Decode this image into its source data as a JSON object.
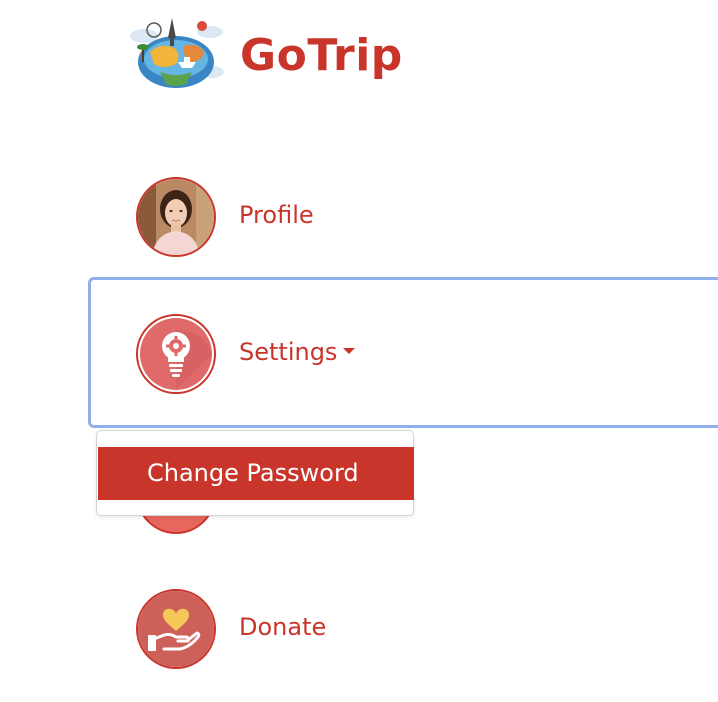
{
  "brand": {
    "name": "GoTrip",
    "logo_icon": "globe-travel-logo"
  },
  "menu": {
    "profile": {
      "label": "Profile",
      "icon": "profile-photo-avatar"
    },
    "settings": {
      "label": "Settings",
      "icon": "lightbulb-gear-icon",
      "expanded": true
    },
    "settings_dropdown": [
      {
        "label": "Change Password",
        "active": true
      }
    ],
    "donate": {
      "label": "Donate",
      "icon": "heart-hand-icon"
    }
  },
  "colors": {
    "accent": "#c9352a",
    "focus_ring": "#8fb0ea",
    "icon_red": "#e7675f",
    "donate_bg": "#cd6058"
  }
}
